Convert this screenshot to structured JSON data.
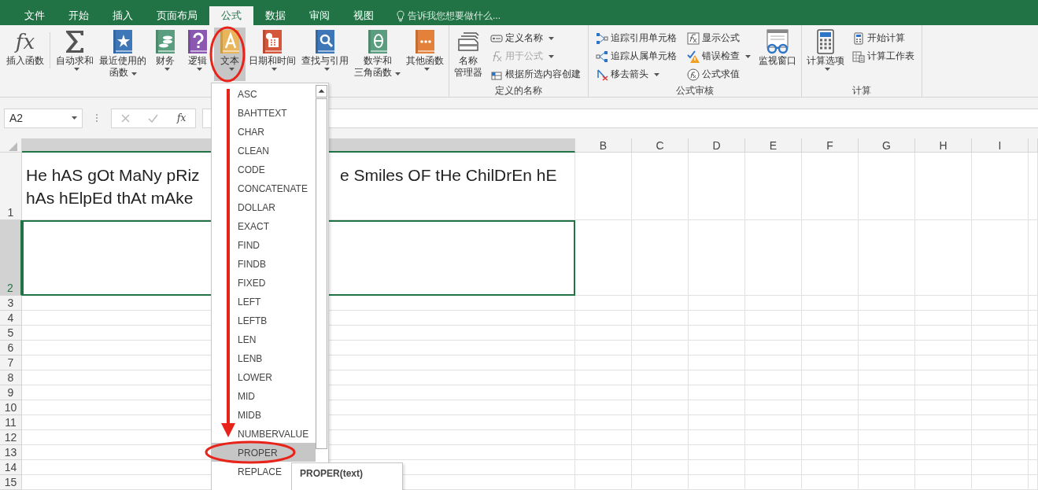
{
  "tabs": [
    {
      "label": "文件",
      "selected": false
    },
    {
      "label": "开始",
      "selected": false
    },
    {
      "label": "插入",
      "selected": false
    },
    {
      "label": "页面布局",
      "selected": false
    },
    {
      "label": "公式",
      "selected": true
    },
    {
      "label": "数据",
      "selected": false
    },
    {
      "label": "审阅",
      "selected": false
    },
    {
      "label": "视图",
      "selected": false
    }
  ],
  "tell_me": "告诉我您想要做什么...",
  "ribbon": {
    "groups": [
      {
        "items": [
          {
            "kind": "large",
            "glyph": "fx",
            "lines": [
              "插入函数"
            ],
            "has_menu": false,
            "pressed": false
          },
          {
            "kind": "large",
            "lines": [
              "自动求和"
            ],
            "has_menu": true,
            "pressed": false
          },
          {
            "kind": "large",
            "lines": [
              "最近使用的",
              "函数"
            ],
            "has_menu": true,
            "pressed": false
          },
          {
            "kind": "large",
            "lines": [
              "财务"
            ],
            "has_menu": true,
            "pressed": false
          },
          {
            "kind": "large",
            "lines": [
              "逻辑"
            ],
            "has_menu": true,
            "pressed": false
          },
          {
            "kind": "large",
            "lines": [
              "文本"
            ],
            "has_menu": true,
            "pressed": true
          },
          {
            "kind": "large",
            "lines": [
              "日期和时间"
            ],
            "has_menu": true,
            "pressed": false
          },
          {
            "kind": "large",
            "lines": [
              "查找与引用"
            ],
            "has_menu": true,
            "pressed": false
          },
          {
            "kind": "large",
            "lines": [
              "数学和",
              "三角函数"
            ],
            "has_menu": true,
            "pressed": false
          },
          {
            "kind": "large",
            "lines": [
              "其他函数"
            ],
            "has_menu": true,
            "pressed": false
          }
        ]
      },
      {
        "label": "定义的名称",
        "items": [
          {
            "kind": "large",
            "lines": [
              "名称",
              "管理器"
            ],
            "has_menu": false,
            "pressed": false
          },
          {
            "kind": "stack",
            "buttons": [
              {
                "label": "定义名称",
                "has_menu": true,
                "disabled": false
              },
              {
                "label": "用于公式",
                "has_menu": true,
                "disabled": true
              },
              {
                "label": "根据所选内容创建",
                "has_menu": false,
                "disabled": false
              }
            ]
          }
        ]
      },
      {
        "label": "公式审核",
        "items": [
          {
            "kind": "stack",
            "buttons": [
              {
                "label": "追踪引用单元格",
                "has_menu": false,
                "disabled": false
              },
              {
                "label": "追踪从属单元格",
                "has_menu": false,
                "disabled": false
              },
              {
                "label": "移去箭头",
                "has_menu": true,
                "disabled": false
              }
            ]
          },
          {
            "kind": "stack",
            "buttons": [
              {
                "label": "显示公式",
                "has_menu": false,
                "disabled": false
              },
              {
                "label": "错误检查",
                "has_menu": true,
                "disabled": false
              },
              {
                "label": "公式求值",
                "has_menu": false,
                "disabled": false
              }
            ]
          },
          {
            "kind": "large",
            "lines": [
              "监视窗口"
            ],
            "has_menu": false,
            "pressed": false
          }
        ]
      },
      {
        "label": "计算",
        "items": [
          {
            "kind": "large",
            "lines": [
              "计算选项"
            ],
            "has_menu": true,
            "pressed": false
          },
          {
            "kind": "stack",
            "buttons": [
              {
                "label": "开始计算",
                "has_menu": false,
                "disabled": false
              },
              {
                "label": "计算工作表",
                "has_menu": false,
                "disabled": false
              }
            ]
          }
        ]
      }
    ]
  },
  "formula_bar": {
    "name_box": "A2",
    "fx": "fx"
  },
  "sheet": {
    "columns": [
      {
        "selected": true
      },
      {
        "label": "B",
        "selected": false
      },
      {
        "label": "C",
        "selected": false
      },
      {
        "label": "D",
        "selected": false
      },
      {
        "label": "E",
        "selected": false
      },
      {
        "label": "F",
        "selected": false
      },
      {
        "label": "G",
        "selected": false
      },
      {
        "label": "H",
        "selected": false
      },
      {
        "label": "I",
        "selected": false
      }
    ],
    "rows": [
      {
        "label": "1",
        "selected": false
      },
      {
        "label": "2",
        "selected": true
      },
      {
        "label": "3",
        "selected": false
      },
      {
        "label": "4",
        "selected": false
      },
      {
        "label": "5",
        "selected": false
      },
      {
        "label": "6",
        "selected": false
      },
      {
        "label": "7",
        "selected": false
      },
      {
        "label": "8",
        "selected": false
      },
      {
        "label": "9",
        "selected": false
      },
      {
        "label": "10",
        "selected": false
      },
      {
        "label": "11",
        "selected": false
      },
      {
        "label": "12",
        "selected": false
      },
      {
        "label": "13",
        "selected": false
      },
      {
        "label": "14",
        "selected": false
      },
      {
        "label": "15",
        "selected": false
      }
    ],
    "a1_visible": [
      "He hAS gOt MaNy pRiz",
      "e Smiles OF tHe ChilDrEn hE",
      "hAs hElpEd thAt mAke"
    ]
  },
  "menu": {
    "items": [
      {
        "label": "ASC",
        "selected": false
      },
      {
        "label": "BAHTTEXT",
        "selected": false
      },
      {
        "label": "CHAR",
        "selected": false
      },
      {
        "label": "CLEAN",
        "selected": false
      },
      {
        "label": "CODE",
        "selected": false
      },
      {
        "label": "CONCATENATE",
        "selected": false
      },
      {
        "label": "DOLLAR",
        "selected": false
      },
      {
        "label": "EXACT",
        "selected": false
      },
      {
        "label": "FIND",
        "selected": false
      },
      {
        "label": "FINDB",
        "selected": false
      },
      {
        "label": "FIXED",
        "selected": false
      },
      {
        "label": "LEFT",
        "selected": false
      },
      {
        "label": "LEFTB",
        "selected": false
      },
      {
        "label": "LEN",
        "selected": false
      },
      {
        "label": "LENB",
        "selected": false
      },
      {
        "label": "LOWER",
        "selected": false
      },
      {
        "label": "MID",
        "selected": false
      },
      {
        "label": "MIDB",
        "selected": false
      },
      {
        "label": "NUMBERVALUE",
        "selected": false
      },
      {
        "label": "PROPER",
        "selected": true
      },
      {
        "label": "REPLACE",
        "selected": false
      }
    ]
  },
  "tooltip": {
    "title": "PROPER(text)"
  }
}
